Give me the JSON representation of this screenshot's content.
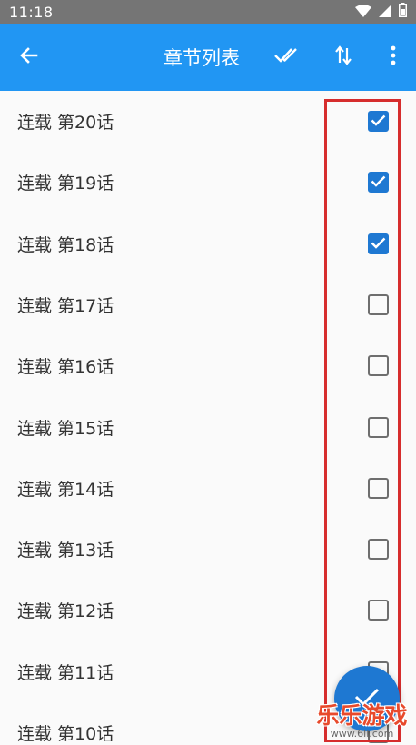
{
  "status_bar": {
    "time": "11:18",
    "icons": [
      "wifi-icon",
      "signal-icon",
      "battery-icon"
    ]
  },
  "app_bar": {
    "title": "章节列表",
    "back_icon": "arrow-left-icon",
    "select_all_icon": "double-check-icon",
    "sort_icon": "sort-arrows-icon",
    "more_icon": "more-vertical-icon",
    "color": "#2196f3"
  },
  "chapters": [
    {
      "label": "连载 第20话",
      "checked": true
    },
    {
      "label": "连载 第19话",
      "checked": true
    },
    {
      "label": "连载 第18话",
      "checked": true
    },
    {
      "label": "连载 第17话",
      "checked": false
    },
    {
      "label": "连载 第16话",
      "checked": false
    },
    {
      "label": "连载 第15话",
      "checked": false
    },
    {
      "label": "连载 第14话",
      "checked": false
    },
    {
      "label": "连载 第13话",
      "checked": false
    },
    {
      "label": "连载 第12话",
      "checked": false
    },
    {
      "label": "连载 第11话",
      "checked": false
    },
    {
      "label": "连载 第10话",
      "checked": false
    }
  ],
  "fab": {
    "icon": "check-icon",
    "color": "#1e78d2"
  },
  "highlight": {
    "color": "#d62d2d"
  },
  "watermark": {
    "text": "乐乐游戏",
    "sub": "www.6ll.com"
  }
}
